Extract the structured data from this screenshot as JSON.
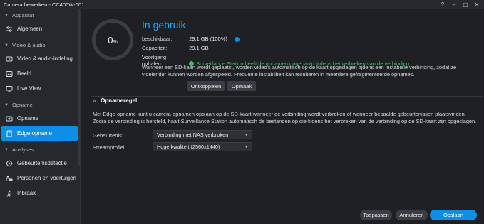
{
  "window": {
    "title": "Camera bewerken - CC400W-001",
    "controls": {
      "help": "?",
      "minimize": "–",
      "maximize": "▢",
      "close": "✕"
    }
  },
  "sidebar": {
    "sections": [
      {
        "label": "Apparaat",
        "items": [
          {
            "label": "Algemeen",
            "icon": "sliders-icon"
          }
        ]
      },
      {
        "label": "Video & audio",
        "items": [
          {
            "label": "Video & audio-indeling",
            "icon": "video-icon"
          },
          {
            "label": "Beeld",
            "icon": "image-icon"
          },
          {
            "label": "Live View",
            "icon": "monitor-icon"
          }
        ]
      },
      {
        "label": "Opname",
        "items": [
          {
            "label": "Opname",
            "icon": "record-icon"
          },
          {
            "label": "Edge-opname",
            "icon": "sd-card-icon",
            "active": true
          }
        ]
      },
      {
        "label": "Analyses",
        "items": [
          {
            "label": "Gebeurtenisdetectie",
            "icon": "target-icon"
          },
          {
            "label": "Personen en voertuigen",
            "icon": "person-vehicle-icon"
          },
          {
            "label": "Inbraak",
            "icon": "intrusion-icon"
          }
        ]
      }
    ]
  },
  "storage": {
    "percent_value": "0",
    "percent_unit": "%",
    "usage_fraction": 0,
    "status": "In gebruik",
    "available_label": "beschikbaar:",
    "available_value": "29.1 GB (100%)",
    "capacity_label": "Capaciteit:",
    "capacity_value": "29.1 GB",
    "progress_label": "Voortgang ophalen:",
    "progress_value": "Surveillance Station heeft de opnamen opgehaald tijdens het verbreken van de verbinding.",
    "description": "Wanneer een SD-kaart wordt geplaatst, worden video's automatisch op de kaart opgeslagen tijdens een instabiele verbinding, zodat ze vloeiender kunnen worden afgespeeld. Frequente instabiliteit kan resulteren in meerdere gefragmenteerde opnames.",
    "unmount_button": "Ontkoppelen",
    "format_button": "Opmaak"
  },
  "recording_rule": {
    "title": "Opnameregel",
    "description": "Met Edge-opname kunt u camera-opnamen opslaan op de SD-kaart wanneer de verbinding wordt verbroken of wanneer bepaalde gebeurtenissen plaatsvinden. Zodra de verbinding is hersteld, haalt Surveillance Station automatisch de bestanden op die tijdens het verbreken van de verbinding op de SD-kaart zijn opgeslagen.",
    "event_label": "Gebeurtenis:",
    "event_value": "Verbinding met NAS verbroken",
    "stream_label": "Streamprofiel:",
    "stream_value": "Hoge kwaliteit (2560x1440)"
  },
  "footer": {
    "apply": "Toepassen",
    "cancel": "Annuleren",
    "save": "Opslaan"
  },
  "colors": {
    "accent": "#0f8ee8",
    "success": "#3ac55a",
    "status": "#2aa3f2"
  }
}
